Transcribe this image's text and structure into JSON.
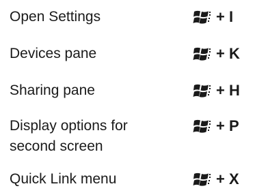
{
  "shortcuts": [
    {
      "label_lines": [
        "Open Settings"
      ],
      "key": "+ I"
    },
    {
      "label_lines": [
        "Devices pane"
      ],
      "key": "+ K"
    },
    {
      "label_lines": [
        "Sharing pane"
      ],
      "key": "+ H"
    },
    {
      "label_lines": [
        "Display options for",
        "second screen"
      ],
      "key": "+ P"
    },
    {
      "label_lines": [
        "Quick Link menu"
      ],
      "key": "+ X"
    }
  ],
  "windows_key_icon": "windows-logo-icon",
  "colors": {
    "text": "#1a1a1a",
    "icon": "#1a1a1a"
  }
}
